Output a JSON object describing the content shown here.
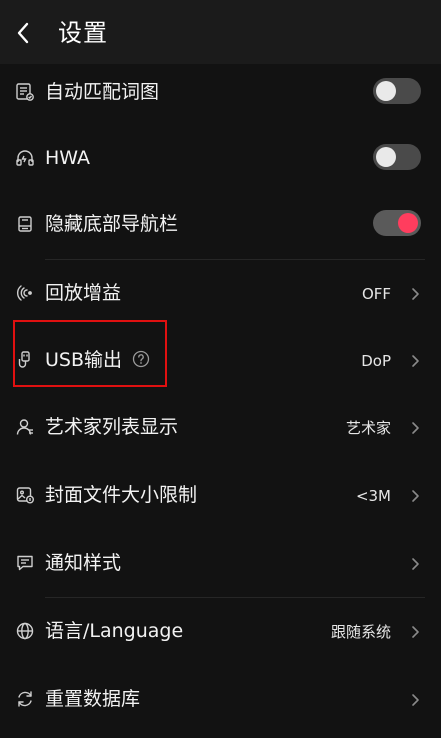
{
  "header": {
    "title": "设置",
    "back_icon": "chevron-left-icon"
  },
  "settings": {
    "auto_match_lyrics": {
      "label": "自动匹配词图",
      "icon": "lyrics-image-icon",
      "toggle_on": false
    },
    "hwa": {
      "label": "HWA",
      "icon": "hardware-acceleration-icon",
      "toggle_on": false
    },
    "hide_nav_bar": {
      "label": "隐藏底部导航栏",
      "icon": "phone-nav-icon",
      "toggle_on": true
    },
    "replay_gain": {
      "label": "回放增益",
      "icon": "sound-waves-icon",
      "value": "OFF"
    },
    "usb_output": {
      "label": "USB输出",
      "icon": "usb-plug-icon",
      "value": "DoP",
      "help_icon": "question-circle-icon"
    },
    "artist_list_display": {
      "label": "艺术家列表显示",
      "icon": "person-icon",
      "value": "艺术家"
    },
    "cover_file_size_limit": {
      "label": "封面文件大小限制",
      "icon": "cover-image-icon",
      "value": "<3M"
    },
    "notification_style": {
      "label": "通知样式",
      "icon": "message-icon"
    },
    "language": {
      "label": "语言/Language",
      "icon": "globe-icon",
      "value": "跟随系统"
    },
    "reset_database": {
      "label": "重置数据库",
      "icon": "refresh-icon"
    }
  },
  "colors": {
    "background": "#121212",
    "header_bg": "#1b1b1b",
    "toggle_accent": "#ff3d5e",
    "highlight": "#e01010"
  }
}
